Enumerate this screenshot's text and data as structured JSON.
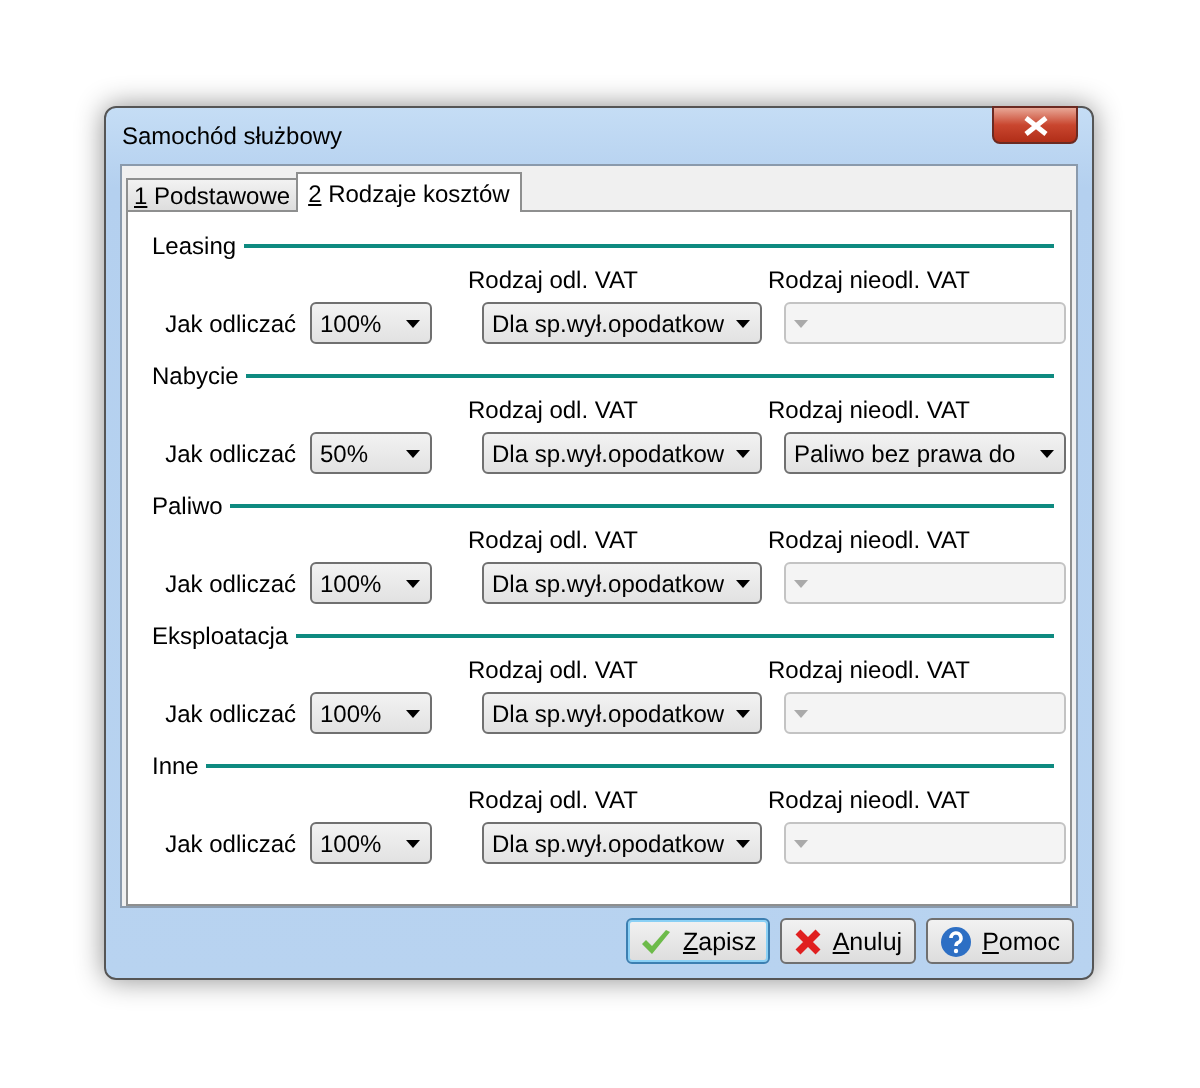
{
  "window": {
    "title": "Samochód służbowy"
  },
  "tabs": [
    {
      "label": "1 Podstawowe",
      "selected": false
    },
    {
      "label": "2 Rodzaje kosztów",
      "selected": true
    }
  ],
  "sections": [
    {
      "title": "Leasing",
      "how_label": "Jak odliczać",
      "how_value": "100%",
      "vat_label": "Rodzaj odl. VAT",
      "vat_value": "Dla sp.wył.opodatkow",
      "nonvat_label": "Rodzaj nieodl. VAT",
      "nonvat_disabled": true
    },
    {
      "title": "Nabycie",
      "how_label": "Jak odliczać",
      "how_value": "50%",
      "vat_label": "Rodzaj odl. VAT",
      "vat_value": "Dla sp.wył.opodatkow",
      "nonvat_label": "Rodzaj nieodl. VAT",
      "nonvat_value": "Paliwo bez prawa do",
      "nonvat_disabled": false
    },
    {
      "title": "Paliwo",
      "how_label": "Jak odliczać",
      "how_value": "100%",
      "vat_label": "Rodzaj odl. VAT",
      "vat_value": "Dla sp.wył.opodatkow",
      "nonvat_label": "Rodzaj nieodl. VAT",
      "nonvat_disabled": true
    },
    {
      "title": "Eksploatacja",
      "how_label": "Jak odliczać",
      "how_value": "100%",
      "vat_label": "Rodzaj odl. VAT",
      "vat_value": "Dla sp.wył.opodatkow",
      "nonvat_label": "Rodzaj nieodl. VAT",
      "nonvat_disabled": true
    },
    {
      "title": "Inne",
      "how_label": "Jak odliczać",
      "how_value": "100%",
      "vat_label": "Rodzaj odl. VAT",
      "vat_value": "Dla sp.wył.opodatkow",
      "nonvat_label": "Rodzaj nieodl. VAT",
      "nonvat_disabled": true
    }
  ],
  "buttons": [
    {
      "kind": "save",
      "label": "Zapisz"
    },
    {
      "kind": "cancel",
      "label": "Anuluj"
    },
    {
      "kind": "help",
      "label": "Pomoc"
    }
  ]
}
